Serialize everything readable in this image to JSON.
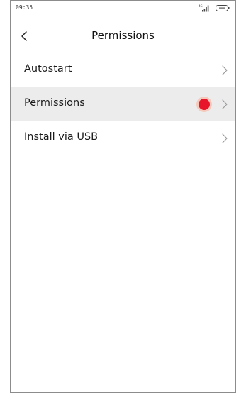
{
  "status_bar": {
    "time": "09:35",
    "icons": [
      "signal-icon",
      "battery-icon"
    ]
  },
  "header": {
    "title": "Permissions",
    "back_icon": "chevron-left-icon"
  },
  "list": {
    "items": [
      {
        "label": "Autostart",
        "icon": "chevron-right-icon"
      },
      {
        "label": "Permissions",
        "icon": "chevron-right-icon"
      },
      {
        "label": "Install via USB",
        "icon": "chevron-right-icon"
      }
    ]
  },
  "colors": {
    "background": "#ffffff",
    "highlight_row": "#ececec",
    "tap_marker": "#e8162a",
    "tap_marker_halo": "#f6c9bd",
    "chevron": "#9a9a9a",
    "text": "#1a1a1a"
  }
}
